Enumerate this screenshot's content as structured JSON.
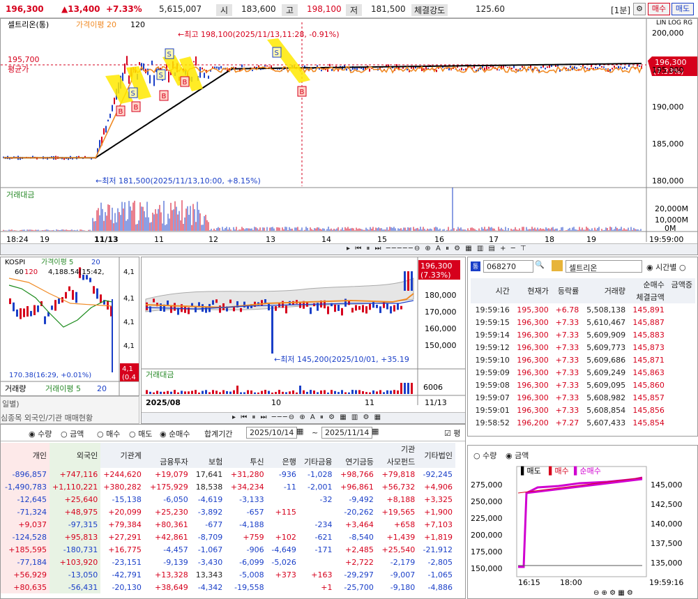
{
  "top": {
    "price": "196,300",
    "change": "▲13,400",
    "pct": "+7.33%",
    "volume": "5,615,007",
    "open_label": "시",
    "open": "183,600",
    "high_label": "고",
    "high": "198,100",
    "low_label": "저",
    "low": "181,500",
    "strength_label": "체결강도",
    "strength": "125.60",
    "interval": "[1분]",
    "buy": "매수",
    "sell": "매도"
  },
  "main_chart": {
    "legend_name": "셀트리온(통)",
    "legend_ma": "가격이평 20",
    "legend_120": "120",
    "btns": [
      "LIN",
      "LOG",
      "RG"
    ],
    "high_note": "←최고 198,100(2025/11/13,11:28, -0.91%)",
    "low_note": "←최저 181,500(2025/11/13,10:00, +8.15%)",
    "avg_price": "195,700",
    "avg_label": "평균가",
    "cur_price": "196,300",
    "cur_pct": "(7.33%)",
    "y_ticks": [
      "200,000",
      "195,000",
      "190,000",
      "185,000",
      "180,000"
    ],
    "vol_label": "거래대금",
    "vol_ticks": [
      "20,000M",
      "10,000M",
      "0M"
    ],
    "x_labels": [
      "18:24",
      "19",
      "11/13",
      "11",
      "12",
      "13",
      "14",
      "15",
      "16",
      "17",
      "18",
      "19"
    ],
    "x_right": "19:59:00",
    "markers": [
      "S",
      "S",
      "S",
      "B",
      "B",
      "B",
      "B",
      "S",
      "B"
    ]
  },
  "kospi": {
    "title": "KOSPI",
    "legend_ma": "가격이평 5",
    "legend_20": "20",
    "legend_60": "60",
    "legend_120": "120",
    "value": "4,188.54(15:42,",
    "low_note": "170.38(16:29, +0.01%)",
    "y_ticks": [
      "4,1",
      "4,1",
      "4,1",
      "4,1"
    ],
    "vol_label": "거래량",
    "vol_ma": "거래이평 5",
    "vol_20": "20",
    "cur": "4,1",
    "cur2": "(0.4"
  },
  "daily": {
    "y_ticks": [
      "180,000",
      "170,000",
      "160,000",
      "150,000"
    ],
    "cur_price": "196,300",
    "cur_pct": "(7.33%)",
    "low_note": "←최저 145,200(2025/10/01, +35.19",
    "vol_label": "거래대금",
    "vol_tick": "6006",
    "x_labels": [
      "2025/08",
      "10",
      "11",
      "11/13"
    ]
  },
  "left_tabs": {
    "t1": "일별)",
    "t2": "심종목 외국인/기관 매매현황"
  },
  "investor": {
    "opts": [
      "수량",
      "금액",
      "매수",
      "매도",
      "순매수"
    ],
    "period_label": "합계기간",
    "from": "2025/10/14",
    "to": "2025/11/14",
    "cols": [
      "개인",
      "외국인",
      "기관계",
      "금융투자",
      "보험",
      "투신",
      "은행",
      "기타금융",
      "연기금등",
      "사모펀드",
      "기타법인"
    ],
    "group": "기관",
    "rows": [
      [
        "-896,857",
        "+747,116",
        "+244,620",
        "+19,079",
        "17,641",
        "+31,280",
        "-936",
        "-1,028",
        "+98,766",
        "+79,818",
        "-92,245"
      ],
      [
        "-1,490,783",
        "+1,110,221",
        "+380,282",
        "+175,929",
        "18,538",
        "+34,234",
        "-11",
        "-2,001",
        "+96,861",
        "+56,732",
        "+4,906"
      ],
      [
        "-12,645",
        "+25,640",
        "-15,138",
        "-6,050",
        "-4,619",
        "-3,133",
        "",
        "-32",
        "-9,492",
        "+8,188",
        "+3,325"
      ],
      [
        "-71,324",
        "+48,975",
        "+20,099",
        "+25,230",
        "-3,892",
        "-657",
        "+115",
        "",
        "-20,262",
        "+19,565",
        "+1,900"
      ],
      [
        "+9,037",
        "-97,315",
        "+79,384",
        "+80,361",
        "-677",
        "-4,188",
        "",
        "-234",
        "+3,464",
        "+658",
        "+7,103"
      ],
      [
        "-124,528",
        "+95,813",
        "+27,291",
        "+42,861",
        "-8,709",
        "+759",
        "+102",
        "-621",
        "-8,540",
        "+1,439",
        "+1,819"
      ],
      [
        "+185,595",
        "-180,731",
        "+16,775",
        "-4,457",
        "-1,067",
        "-906",
        "-4,649",
        "-171",
        "+2,485",
        "+25,540",
        "-21,912"
      ],
      [
        "-77,184",
        "+103,920",
        "-23,151",
        "-9,139",
        "-3,430",
        "-6,099",
        "-5,026",
        "",
        "+2,722",
        "-2,179",
        "-2,805"
      ],
      [
        "+56,929",
        "-13,050",
        "-42,791",
        "+13,328",
        "13,343",
        "-5,008",
        "+373",
        "+163",
        "-29,297",
        "-9,007",
        "-1,065"
      ],
      [
        "+80,635",
        "-56,431",
        "-20,130",
        "+38,649",
        "-4,342",
        "-19,558",
        "",
        "+1",
        "-25,700",
        "-9,180",
        "-4,886"
      ]
    ]
  },
  "ticks": {
    "code": "068270",
    "name": "셀트리온",
    "mode": "시간별",
    "cols": [
      "시간",
      "현재가",
      "등락률",
      "거래량",
      "순매수",
      "체결금액",
      "금액증"
    ],
    "sub": "체결금액",
    "rows": [
      [
        "19:59:16",
        "195,300",
        "+6.78",
        "5,508,138",
        "145,891"
      ],
      [
        "19:59:15",
        "196,300",
        "+7.33",
        "5,610,467",
        "145,887"
      ],
      [
        "19:59:14",
        "196,300",
        "+7.33",
        "5,609,909",
        "145,883"
      ],
      [
        "19:59:12",
        "196,300",
        "+7.33",
        "5,609,773",
        "145,873"
      ],
      [
        "19:59:10",
        "196,300",
        "+7.33",
        "5,609,686",
        "145,871"
      ],
      [
        "19:59:09",
        "196,300",
        "+7.33",
        "5,609,249",
        "145,863"
      ],
      [
        "19:59:08",
        "196,300",
        "+7.33",
        "5,609,095",
        "145,860"
      ],
      [
        "19:59:07",
        "196,300",
        "+7.33",
        "5,608,982",
        "145,857"
      ],
      [
        "19:59:01",
        "196,300",
        "+7.33",
        "5,608,854",
        "145,856"
      ],
      [
        "19:58:52",
        "196,200",
        "+7.27",
        "5,607,433",
        "145,854"
      ]
    ]
  },
  "flow": {
    "opts": [
      "수량",
      "금액"
    ],
    "legend": [
      "매도",
      "매수",
      "순매수"
    ],
    "left_ticks": [
      "275,000",
      "250,000",
      "225,000",
      "200,000",
      "175,000",
      "150,000"
    ],
    "right_ticks": [
      "145,000",
      "142,500",
      "140,000",
      "137,500",
      "135,000"
    ],
    "x_labels": [
      "16:15",
      "18:00",
      "19:59:16"
    ]
  }
}
